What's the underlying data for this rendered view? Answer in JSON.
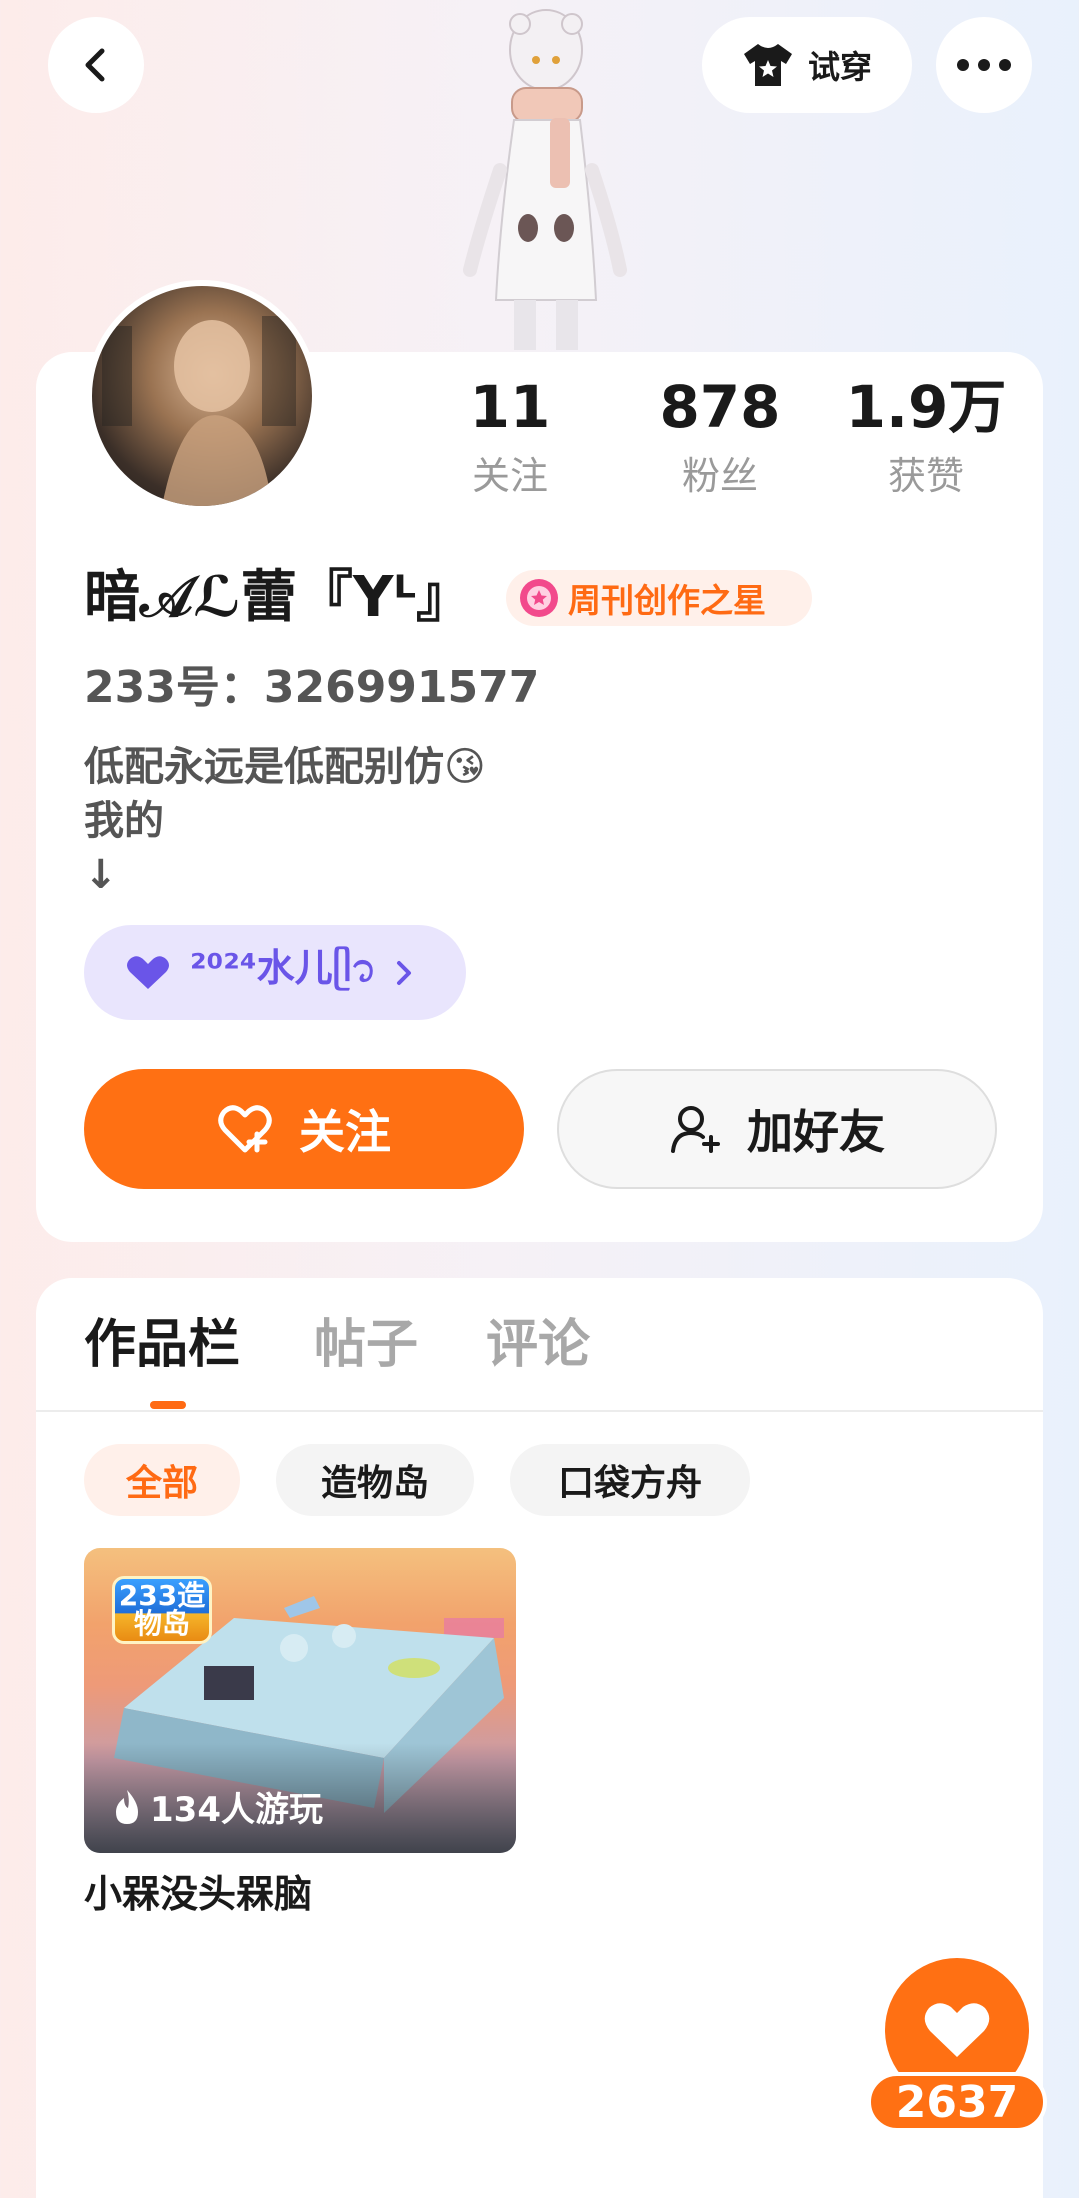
{
  "topbar": {
    "back_icon": "chevron-left-icon",
    "tryon_label": "试穿",
    "tryon_icon": "shirt-icon",
    "more_icon": "more-dots-icon"
  },
  "profile": {
    "stats": [
      {
        "value": "11",
        "label": "关注"
      },
      {
        "value": "878",
        "label": "粉丝"
      },
      {
        "value": "1.9万",
        "label": "获赞"
      }
    ],
    "nickname": "暗𝒜ℒ蕾『Yᴸ』",
    "badge": {
      "label": "周刊创作之星",
      "icon": "star-medal-icon"
    },
    "uid": "233号：326991577",
    "bio": "低配永远是低配别仿😘\n我的\n↓",
    "tag": {
      "label": "²⁰²⁴水儿ᥫ᭡",
      "icon": "heart-icon",
      "arrow_icon": "chevron-right-icon"
    },
    "follow_label": "关注",
    "add_friend_label": "加好友"
  },
  "works": {
    "tabs": [
      "作品栏",
      "帖子",
      "评论"
    ],
    "active_tab": 0,
    "filters": [
      "全部",
      "造物岛",
      "口袋方舟"
    ],
    "items": [
      {
        "logo": "233造物岛",
        "players": "134人游玩",
        "title": "小槑没头槑脑"
      }
    ]
  },
  "like": {
    "count": "2637",
    "icon": "heart-icon"
  },
  "colors": {
    "accent": "#ff7013",
    "tag_bg": "#e9e5fd",
    "tag_text": "#6a55e8"
  }
}
